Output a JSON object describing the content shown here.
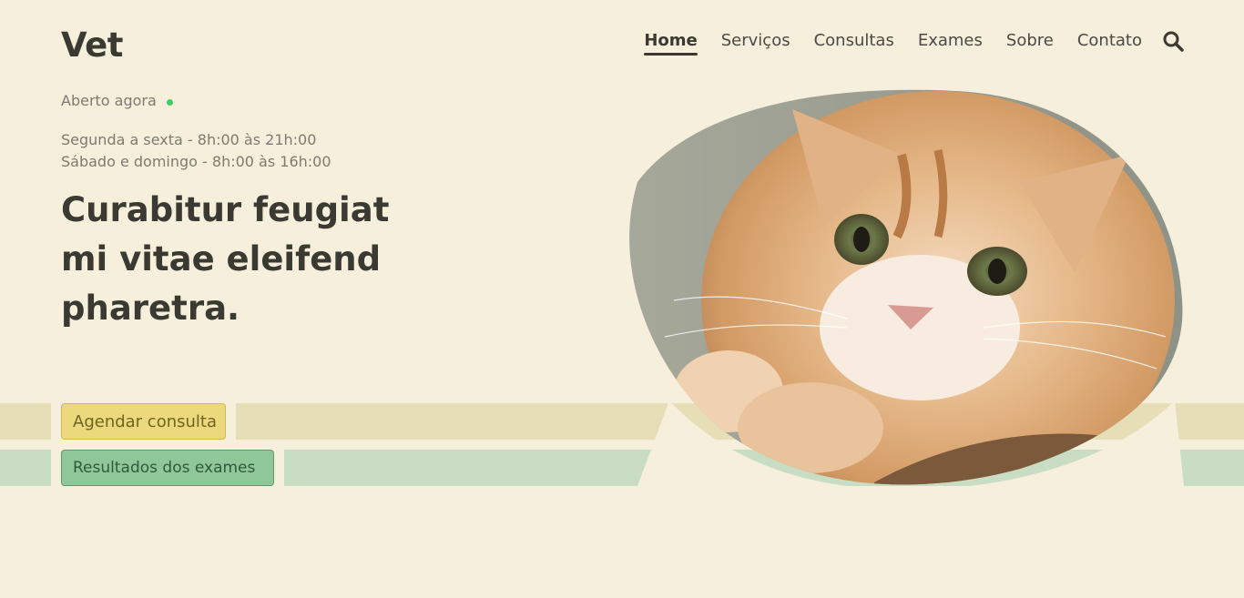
{
  "header": {
    "logo": "Vet",
    "nav": [
      {
        "label": "Home",
        "active": true
      },
      {
        "label": "Serviços",
        "active": false
      },
      {
        "label": "Consultas",
        "active": false
      },
      {
        "label": "Exames",
        "active": false
      },
      {
        "label": "Sobre",
        "active": false
      },
      {
        "label": "Contato",
        "active": false
      }
    ],
    "search_icon": "search-icon"
  },
  "status": {
    "open_label": "Aberto agora",
    "open_color": "#3ecf6a"
  },
  "hours": {
    "weekdays": "Segunda a sexta - 8h:00 às 21h:00",
    "weekend": "Sábado e domingo - 8h:00 às 16h:00"
  },
  "hero": {
    "headline_line1": "Curabitur feugiat",
    "headline_line2": "mi vitae eleifend",
    "headline_line3": "pharetra.",
    "image_subject": "cat-photo"
  },
  "actions": {
    "schedule_label": "Agendar consulta",
    "results_label": "Resultados dos exames"
  },
  "colors": {
    "background": "#f5efdc",
    "text": "#3a3a33",
    "yellow_band": "#e5deb7",
    "green_band": "#c8ddc4",
    "yellow_button": "#ecd97e",
    "green_button": "#8fc79b"
  }
}
